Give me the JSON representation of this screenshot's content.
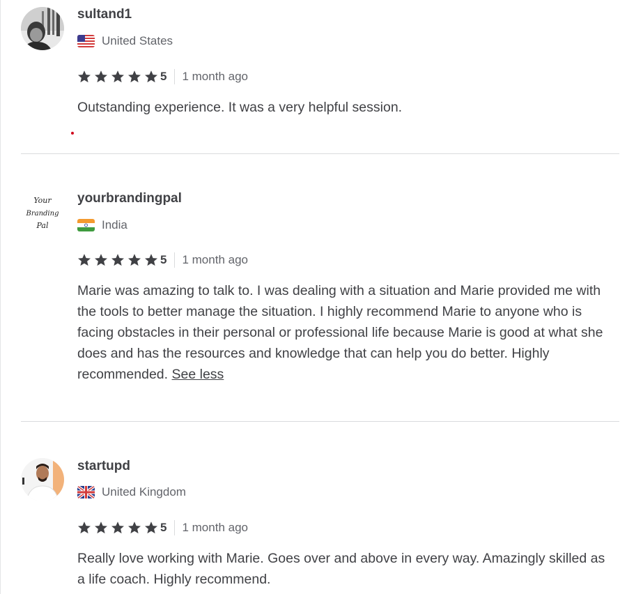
{
  "reviews": [
    {
      "username": "sultand1",
      "country": "United States",
      "flag_icon": "us-flag-icon",
      "rating": "5",
      "time": "1 month ago",
      "text": "Outstanding experience. It was a very helpful session.",
      "see_less": ""
    },
    {
      "username": "yourbrandingpal",
      "country": "India",
      "flag_icon": "india-flag-icon",
      "rating": "5",
      "time": "1 month ago",
      "text": "Marie was amazing to talk to. I was dealing with a situation and Marie provided me with the tools to better manage the situation. I highly recommend Marie to anyone who is facing obstacles in their personal or professional life because Marie is good at what she does and has the resources and knowledge that can help you do better. Highly recommended.",
      "see_less": "See less",
      "avatar_logo": [
        "Your",
        "Branding",
        "Pal"
      ]
    },
    {
      "username": "startupd",
      "country": "United Kingdom",
      "flag_icon": "uk-flag-icon",
      "rating": "5",
      "time": "1 month ago",
      "text": "Really love working with Marie. Goes over and above in every way. Amazingly skilled as a life coach. Highly recommend.",
      "see_less": ""
    }
  ],
  "colors": {
    "star": "#404145",
    "text": "#404145",
    "muted": "#62646a",
    "divider": "#dadbdd"
  }
}
